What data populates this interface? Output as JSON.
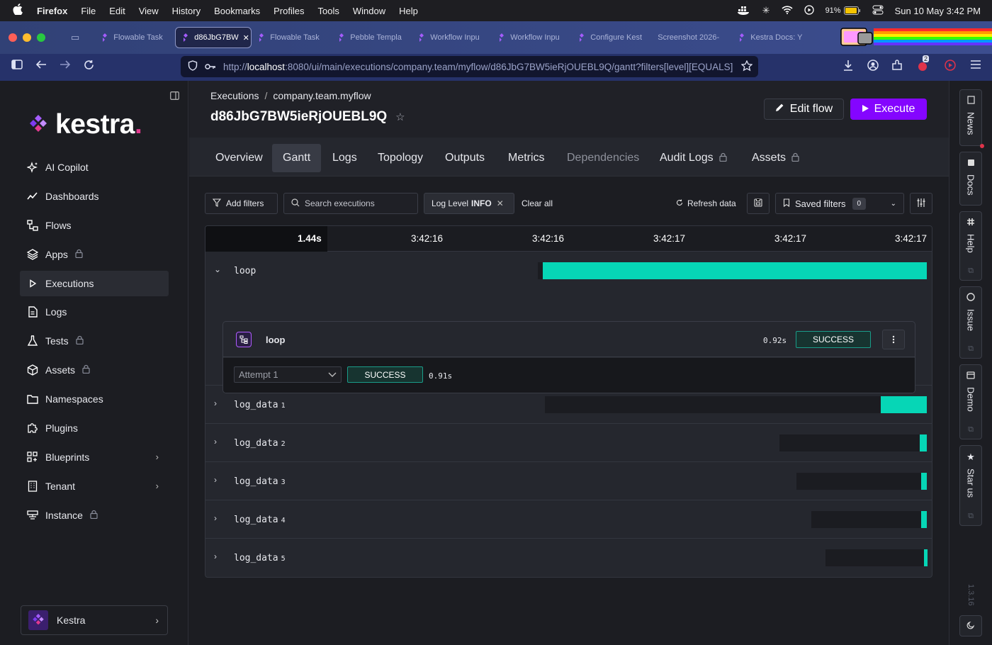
{
  "menubar": {
    "items": [
      "Firefox",
      "File",
      "Edit",
      "View",
      "History",
      "Bookmarks",
      "Profiles",
      "Tools",
      "Window",
      "Help"
    ],
    "battery": "91%",
    "datetime": "Sun 10 May  3:42 PM"
  },
  "browser": {
    "tabs": [
      {
        "label": "Flowable Task",
        "active": false
      },
      {
        "label": "d86JbG7BW",
        "active": true
      },
      {
        "label": "Flowable Task",
        "active": false
      },
      {
        "label": "Pebble Templa",
        "active": false
      },
      {
        "label": "Workflow Inpu",
        "active": false
      },
      {
        "label": "Workflow Inpu",
        "active": false
      },
      {
        "label": "Configure Kest",
        "active": false
      },
      {
        "label": "Screenshot 2026-",
        "active": false
      },
      {
        "label": "Kestra Docs: Y",
        "active": false
      }
    ],
    "url_prefix": "http://",
    "url_host": "localhost",
    "url_rest": ":8080/ui/main/executions/company.team/myflow/d86JbG7BW5ieRjOUEBL9Q/gantt?filters[level][EQUALS]",
    "notification_count": "2"
  },
  "sidebar": {
    "logo_text": "kestra",
    "logo_dot": ".",
    "items": [
      {
        "label": "AI Copilot",
        "icon": "ai-copilot-icon"
      },
      {
        "label": "Dashboards",
        "icon": "chart-line-icon"
      },
      {
        "label": "Flows",
        "icon": "flows-icon"
      },
      {
        "label": "Apps",
        "icon": "apps-icon",
        "locked": true
      },
      {
        "label": "Executions",
        "icon": "play-icon",
        "active": true
      },
      {
        "label": "Logs",
        "icon": "file-icon"
      },
      {
        "label": "Tests",
        "icon": "flask-icon",
        "locked": true
      },
      {
        "label": "Assets",
        "icon": "cube-icon",
        "locked": true
      },
      {
        "label": "Namespaces",
        "icon": "folder-icon"
      },
      {
        "label": "Plugins",
        "icon": "puzzle-icon"
      },
      {
        "label": "Blueprints",
        "icon": "blueprint-icon",
        "submenu": true
      },
      {
        "label": "Tenant",
        "icon": "building-icon",
        "submenu": true
      },
      {
        "label": "Instance",
        "icon": "server-icon",
        "locked": true
      }
    ],
    "footer_label": "Kestra"
  },
  "header": {
    "breadcrumb": [
      "Executions",
      "company.team.myflow"
    ],
    "execution_id": "d86JbG7BW5ieRjOUEBL9Q",
    "edit_label": "Edit flow",
    "execute_label": "Execute"
  },
  "tabs": [
    {
      "label": "Overview"
    },
    {
      "label": "Gantt",
      "active": true
    },
    {
      "label": "Logs"
    },
    {
      "label": "Topology"
    },
    {
      "label": "Outputs"
    },
    {
      "label": "Metrics"
    },
    {
      "label": "Dependencies",
      "dim": true
    },
    {
      "label": "Audit Logs",
      "locked": true
    },
    {
      "label": "Assets",
      "locked": true
    }
  ],
  "filters": {
    "add_label": "Add filters",
    "search_placeholder": "Search executions",
    "chip_key": "Log Level",
    "chip_value": "INFO",
    "clear_label": "Clear all",
    "refresh_label": "Refresh data",
    "saved_label": "Saved filters",
    "saved_count": "0"
  },
  "gantt": {
    "header_times": [
      "1.44s",
      "3:42:16",
      "3:42:16",
      "3:42:17",
      "3:42:17",
      "3:42:17"
    ],
    "total_duration_s": 1.44,
    "rows": [
      {
        "name": "loop",
        "index": "",
        "expanded": true,
        "start": 0.345,
        "end": 1.0,
        "bar_start": 0.353
      },
      {
        "name": "log_data",
        "index": "1",
        "start": 0.357,
        "end": 1.0,
        "bar_start": 0.923
      },
      {
        "name": "log_data",
        "index": "2",
        "start": 0.752,
        "end": 1.0,
        "bar_start": 0.988
      },
      {
        "name": "log_data",
        "index": "3",
        "start": 0.78,
        "end": 1.0,
        "bar_start": 0.99
      },
      {
        "name": "log_data",
        "index": "4",
        "start": 0.805,
        "end": 1.0,
        "bar_start": 0.99
      },
      {
        "name": "log_data",
        "index": "5",
        "start": 0.829,
        "end": 1.0,
        "bar_start": 0.995
      }
    ],
    "detail": {
      "task_name": "loop",
      "duration": "0.92s",
      "status": "SUCCESS",
      "attempt_label": "Attempt 1",
      "attempt_status": "SUCCESS",
      "attempt_duration": "0.91s"
    }
  },
  "rightrail": {
    "items": [
      "News",
      "Docs",
      "Help",
      "Issue",
      "Demo",
      "Star us"
    ],
    "version": "1.3.16"
  },
  "colors": {
    "accent": "#8405ff",
    "bar": "#06d6b6",
    "success_border": "#1a9d8a"
  }
}
